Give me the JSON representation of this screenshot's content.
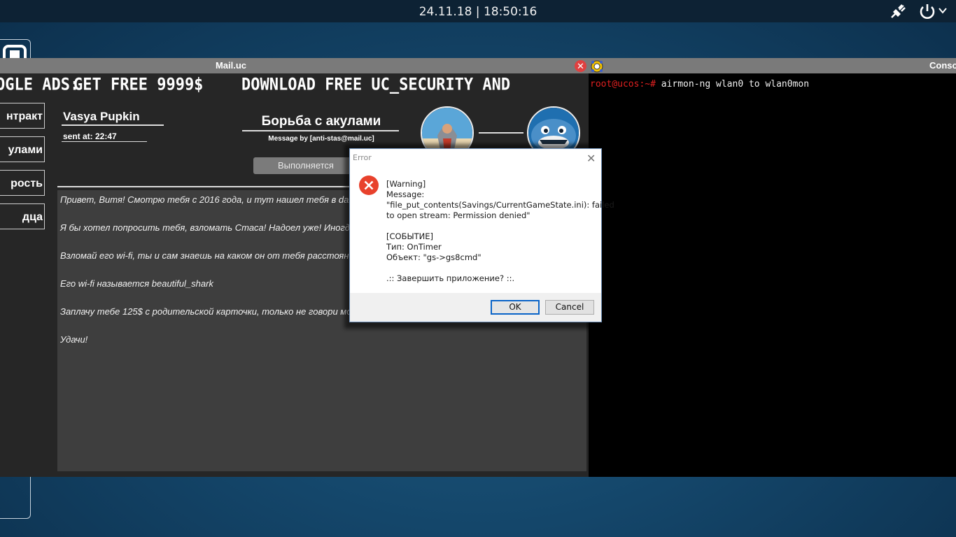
{
  "topbar": {
    "datetime": "24.11.18 | 18:50:16",
    "icons": [
      "network-plug-icon",
      "power-icon",
      "chevron-down-icon"
    ]
  },
  "mail_window": {
    "title": "Mail.uc",
    "close_glyph": "✕",
    "banner": {
      "left": "OGLE ADS:",
      "middle": "GET FREE 9999$",
      "right": "DOWNLOAD FREE UC_SECURITY AND"
    },
    "nav": [
      "нтракт",
      "улами",
      "рость",
      "дца"
    ],
    "message": {
      "sender": "Vasya Pupkin",
      "sent_at": "sent at: 22:47",
      "subject": "Борьба с акулами",
      "message_by": "Message by [anti-stas@mail.uc]",
      "action_button": "Выполняется",
      "paragraphs": [
        "Привет, Витя! Смотрю тебя с 2016 года, и тут нашел тебя в darkn",
        "Я бы хотел попросить тебя, взломать Стаса! Надоел уже! Иногда с",
        "Взломай его wi-fi, ты и сам знаешь на каком он от тебя расстоянии!",
        "Его wi-fi называется beautiful_shark",
        "Заплачу тебе 125$ с родительской карточки, только не говори моей",
        "Удачи!"
      ]
    }
  },
  "console_window": {
    "title": "Conso",
    "prompt": "root@ucos:~#",
    "command": " airmon-ng wlan0 to wlan0mon"
  },
  "error_dialog": {
    "title": "Error",
    "close_glyph": "✕",
    "lines": [
      "[Warning]",
      "Message:",
      "\"file_put_contents(Savings/CurrentGameState.ini): failed",
      "to open stream: Permission denied\"",
      "",
      "[СОБЫТИЕ]",
      "Тип: OnTimer",
      "Объект: \"gs->gs8cmd\"",
      "",
      ".:: Завершить приложение? ::."
    ],
    "ok_label": "OK",
    "cancel_label": "Cancel"
  }
}
